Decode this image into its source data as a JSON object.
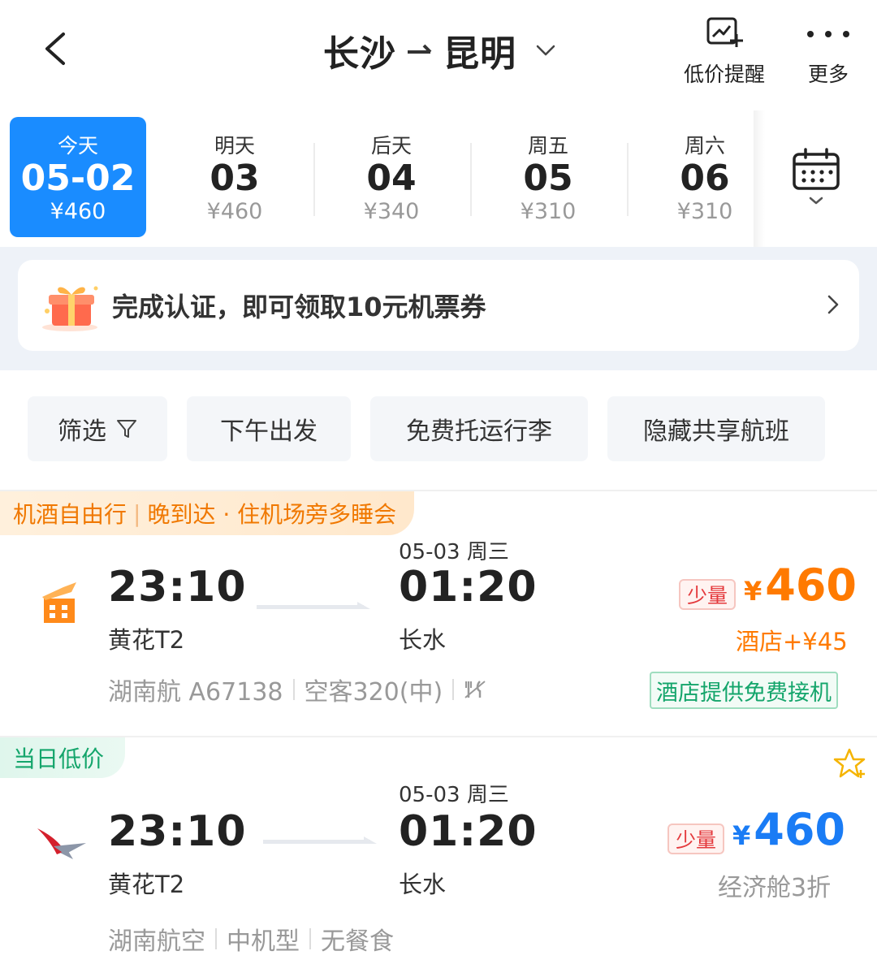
{
  "header": {
    "origin": "长沙",
    "destination": "昆明",
    "actions": [
      {
        "label": "低价提醒",
        "icon": "price-alert-icon"
      },
      {
        "label": "更多",
        "icon": "more-dots-icon"
      }
    ]
  },
  "dates": [
    {
      "label": "今天",
      "num": "05-02",
      "price": "¥460",
      "active": true
    },
    {
      "label": "明天",
      "num": "03",
      "price": "¥460"
    },
    {
      "label": "后天",
      "num": "04",
      "price": "¥340"
    },
    {
      "label": "周五",
      "num": "05",
      "price": "¥310"
    },
    {
      "label": "周六",
      "num": "06",
      "price": "¥310"
    }
  ],
  "banner": {
    "text": "完成认证，即可领取10元机票券"
  },
  "filters": [
    {
      "label": "筛选",
      "icon": "filter-funnel-icon"
    },
    {
      "label": "下午出发"
    },
    {
      "label": "免费托运行李"
    },
    {
      "label": "隐藏共享航班"
    }
  ],
  "flights": [
    {
      "tag_parts": [
        "机酒自由行",
        "晚到达 · 住机场旁多睡会"
      ],
      "icon": "flight-hotel-icon",
      "dep_time": "23:10",
      "dep_airport": "黄花T2",
      "arr_date": "05-03 周三",
      "arr_time": "01:20",
      "arr_airport": "长水",
      "meta": [
        "湖南航 A67138",
        "空客320(中)"
      ],
      "meal_icon": "no-meal-icon",
      "badge": "少量",
      "currency": "¥",
      "price": "460",
      "hotel_add": "酒店+¥45",
      "hotel_badge": "酒店提供免费接机"
    },
    {
      "tag": "当日低价",
      "icon": "hunan-airlines-logo-icon",
      "dep_time": "23:10",
      "dep_airport": "黄花T2",
      "arr_date": "05-03 周三",
      "arr_time": "01:20",
      "arr_airport": "长水",
      "meta": [
        "湖南航空",
        "中机型",
        "无餐食"
      ],
      "badge": "少量",
      "currency": "¥",
      "price": "460",
      "discount": "经济舱3折"
    }
  ],
  "colors": {
    "primary": "#1a8cff",
    "orange": "#ff7a00",
    "price_blue": "#1a7cf5",
    "green": "#14a56b",
    "alert_red": "#e4393c"
  }
}
